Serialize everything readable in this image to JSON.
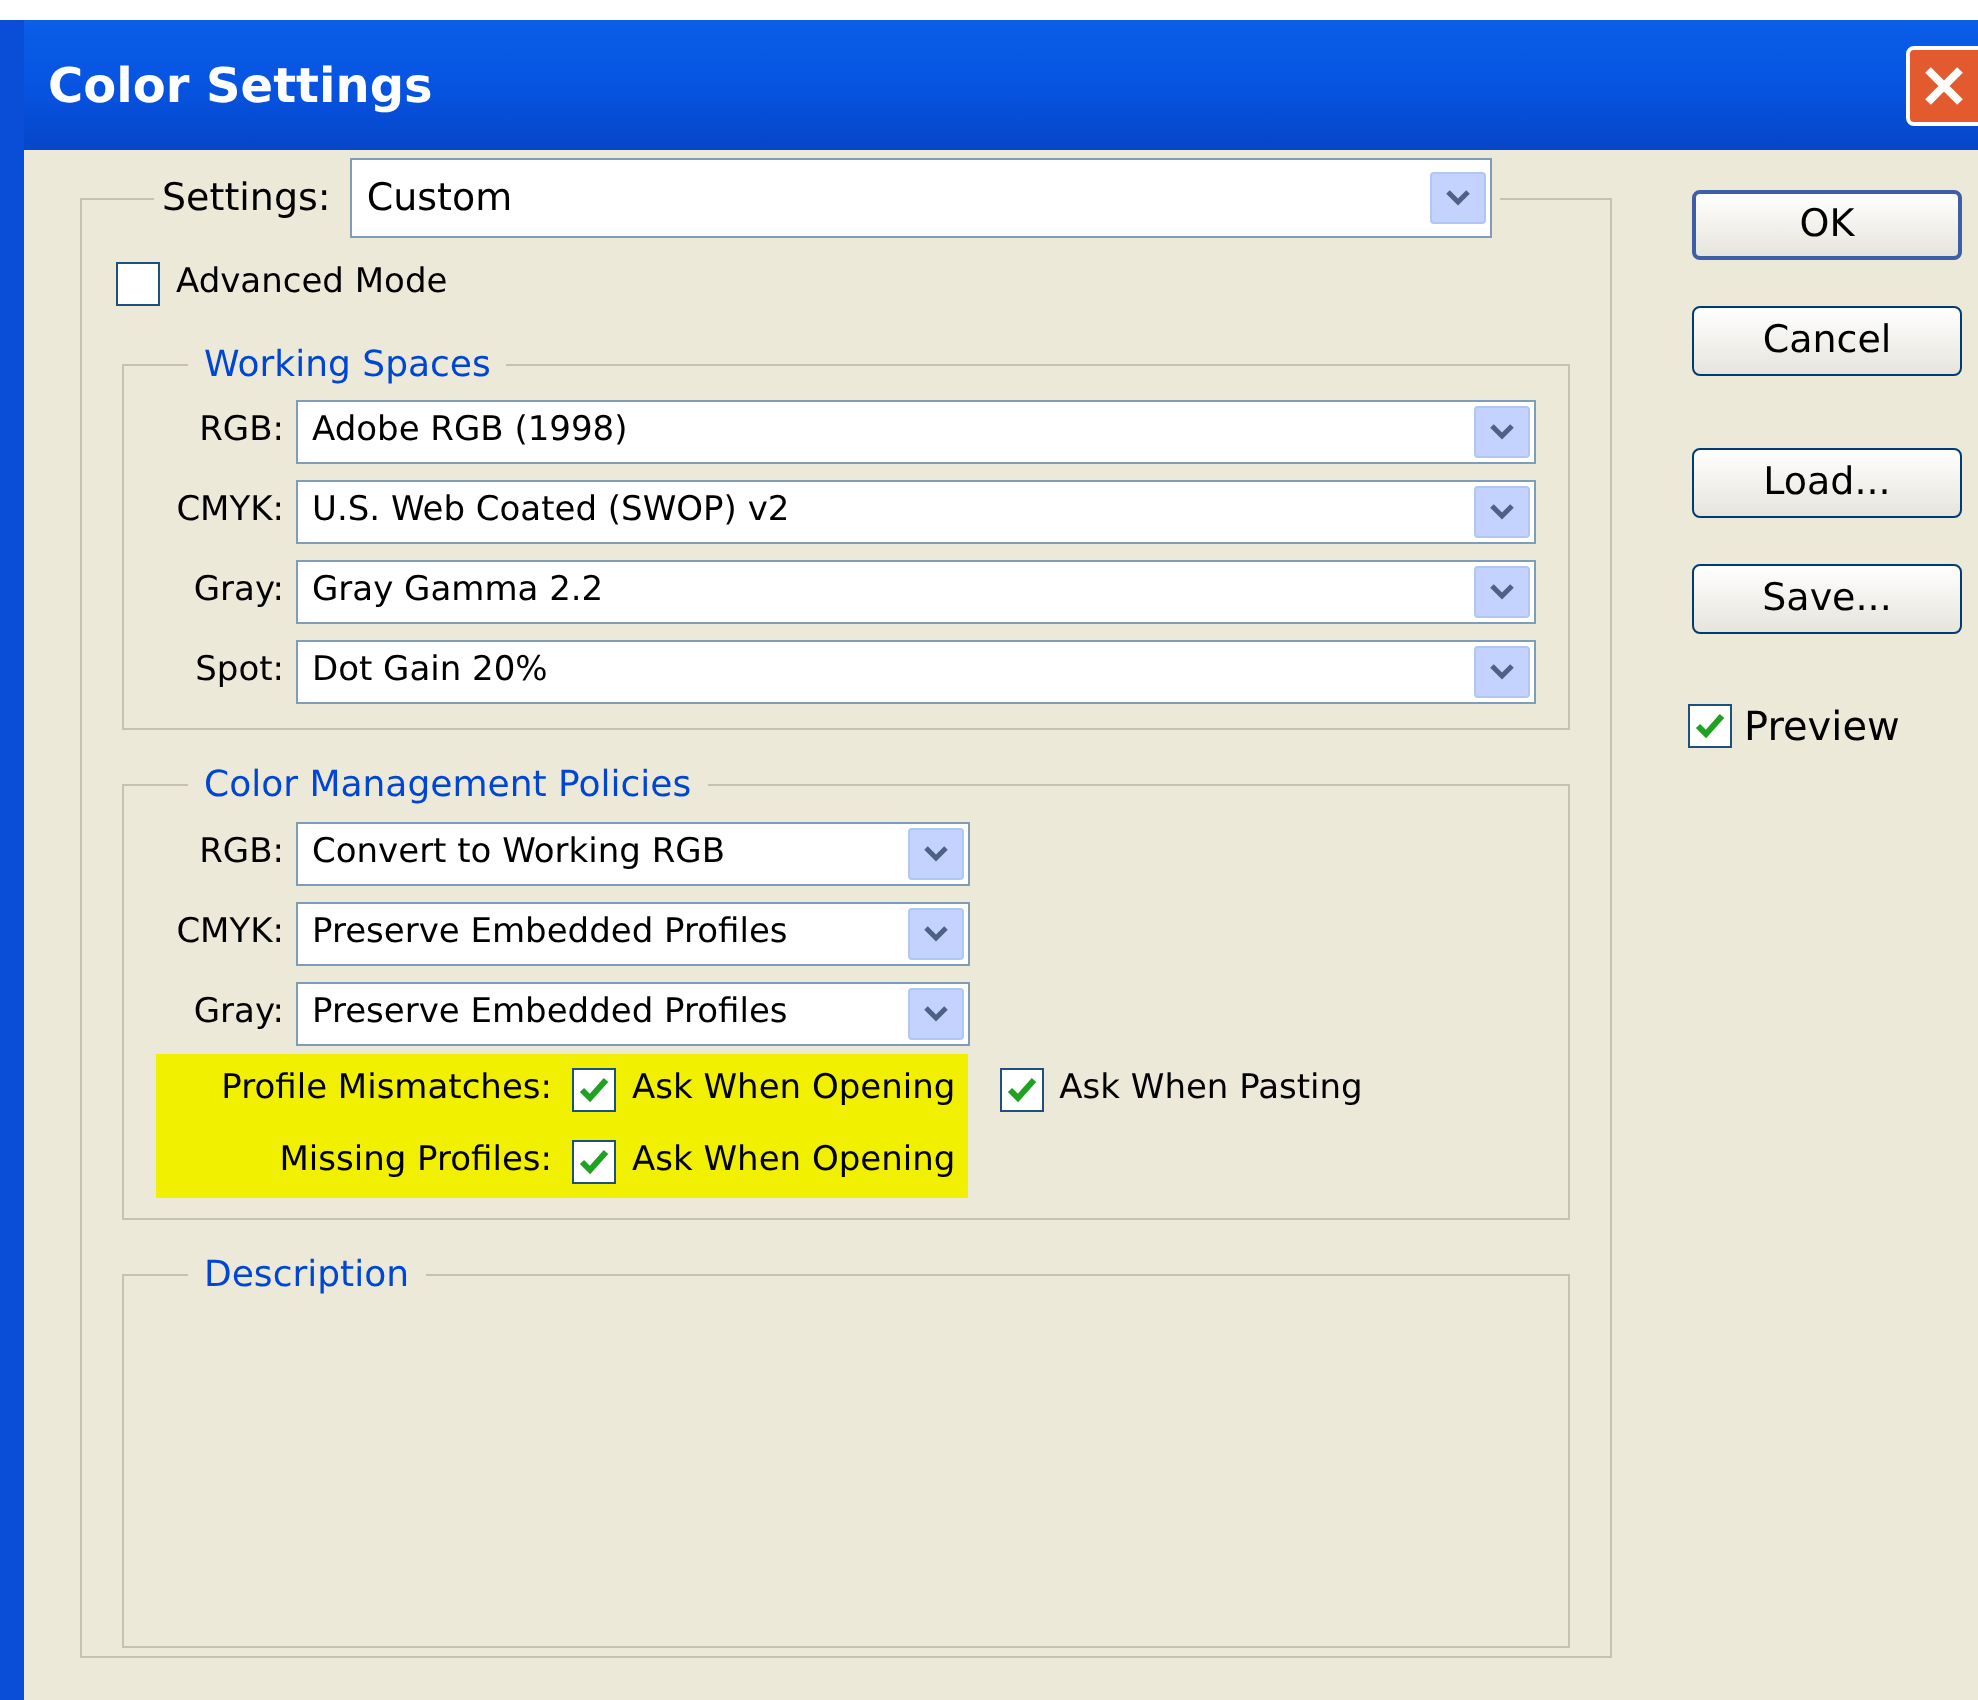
{
  "window": {
    "title": "Color Settings"
  },
  "settings": {
    "label": "Settings:",
    "value": "Custom"
  },
  "advanced_mode": {
    "label": "Advanced Mode",
    "checked": false
  },
  "working_spaces": {
    "title": "Working Spaces",
    "rows": [
      {
        "label": "RGB:",
        "value": "Adobe RGB (1998)"
      },
      {
        "label": "CMYK:",
        "value": "U.S. Web Coated (SWOP) v2"
      },
      {
        "label": "Gray:",
        "value": "Gray Gamma 2.2"
      },
      {
        "label": "Spot:",
        "value": "Dot Gain 20%"
      }
    ]
  },
  "policies": {
    "title": "Color Management Policies",
    "rows": [
      {
        "label": "RGB:",
        "value": "Convert to Working RGB"
      },
      {
        "label": "CMYK:",
        "value": "Preserve Embedded Profiles"
      },
      {
        "label": "Gray:",
        "value": "Preserve Embedded Profiles"
      }
    ],
    "checks": [
      {
        "label": "Profile Mismatches:",
        "highlighted": true,
        "options": [
          {
            "label": "Ask When Opening",
            "checked": true,
            "highlighted": true
          },
          {
            "label": "Ask When Pasting",
            "checked": true,
            "highlighted": false
          }
        ]
      },
      {
        "label": "Missing Profiles:",
        "highlighted": true,
        "options": [
          {
            "label": "Ask When Opening",
            "checked": true,
            "highlighted": true
          }
        ]
      }
    ]
  },
  "description": {
    "title": "Description"
  },
  "buttons": [
    {
      "label": "OK",
      "default": true
    },
    {
      "label": "Cancel",
      "default": false
    },
    {
      "label": "Load...",
      "default": false
    },
    {
      "label": "Save...",
      "default": false
    }
  ],
  "preview": {
    "label": "Preview",
    "checked": true
  }
}
